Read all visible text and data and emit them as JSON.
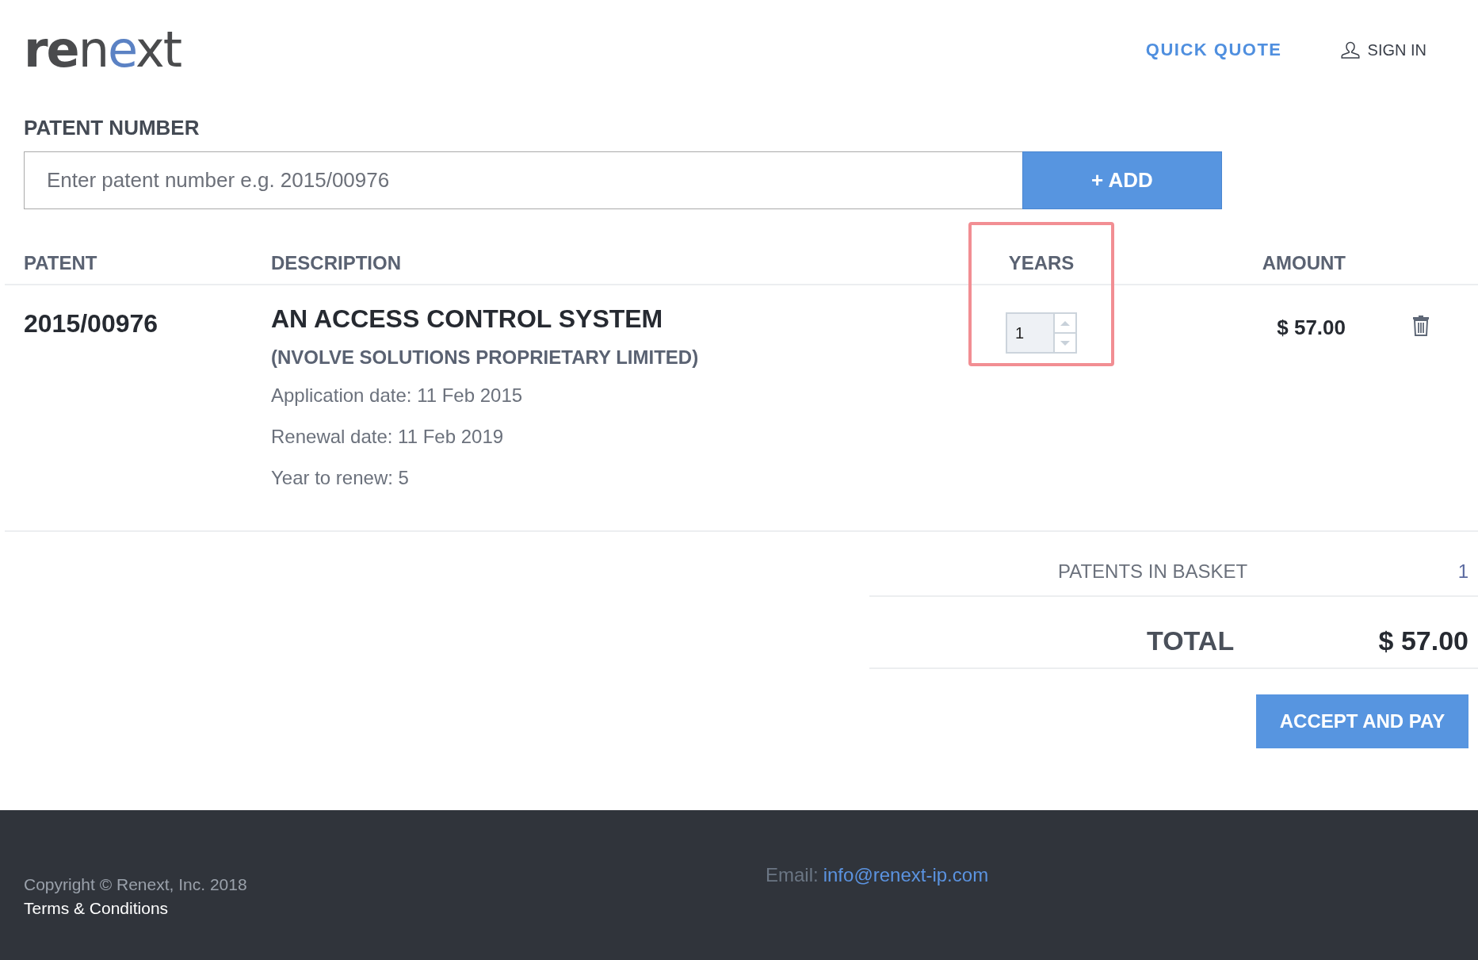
{
  "header": {
    "logo": [
      {
        "text": "re",
        "kind": "bold"
      },
      {
        "text": "n",
        "kind": "plain"
      },
      {
        "text": "e",
        "kind": "accent"
      },
      {
        "text": "xt",
        "kind": "plain"
      }
    ],
    "nav": [
      {
        "label": "QUICK QUOTE",
        "kind": "link"
      },
      {
        "label": "SIGN IN",
        "kind": "user"
      }
    ]
  },
  "patent_search": {
    "label": "PATENT NUMBER",
    "placeholder": "Enter patent number e.g. 2015/00976",
    "button": "+ ADD"
  },
  "table": {
    "columns": [
      "PATENT",
      "DESCRIPTION",
      "YEARS",
      "AMOUNT"
    ],
    "rows": [
      {
        "patent": "2015/00976",
        "title": "AN ACCESS CONTROL SYSTEM",
        "owner": "(NVOLVE SOLUTIONS PROPRIETARY LIMITED)",
        "details": [
          "Application date: 11 Feb 2015",
          "Renewal date: 11 Feb 2019",
          "Year to renew: 5"
        ],
        "years": "1",
        "amount": "$ 57.00",
        "highlighted": true
      }
    ]
  },
  "summary": {
    "count_label": "PATENTS IN BASKET",
    "count": "1",
    "total_label": "TOTAL",
    "total": "$ 57.00",
    "button": "ACCEPT AND PAY"
  },
  "footer": {
    "copyright": "Copyright © Renext, Inc. 2018",
    "terms": "Terms & Conditions",
    "email_label": "Email:",
    "email": "info@renext-ip.com"
  }
}
